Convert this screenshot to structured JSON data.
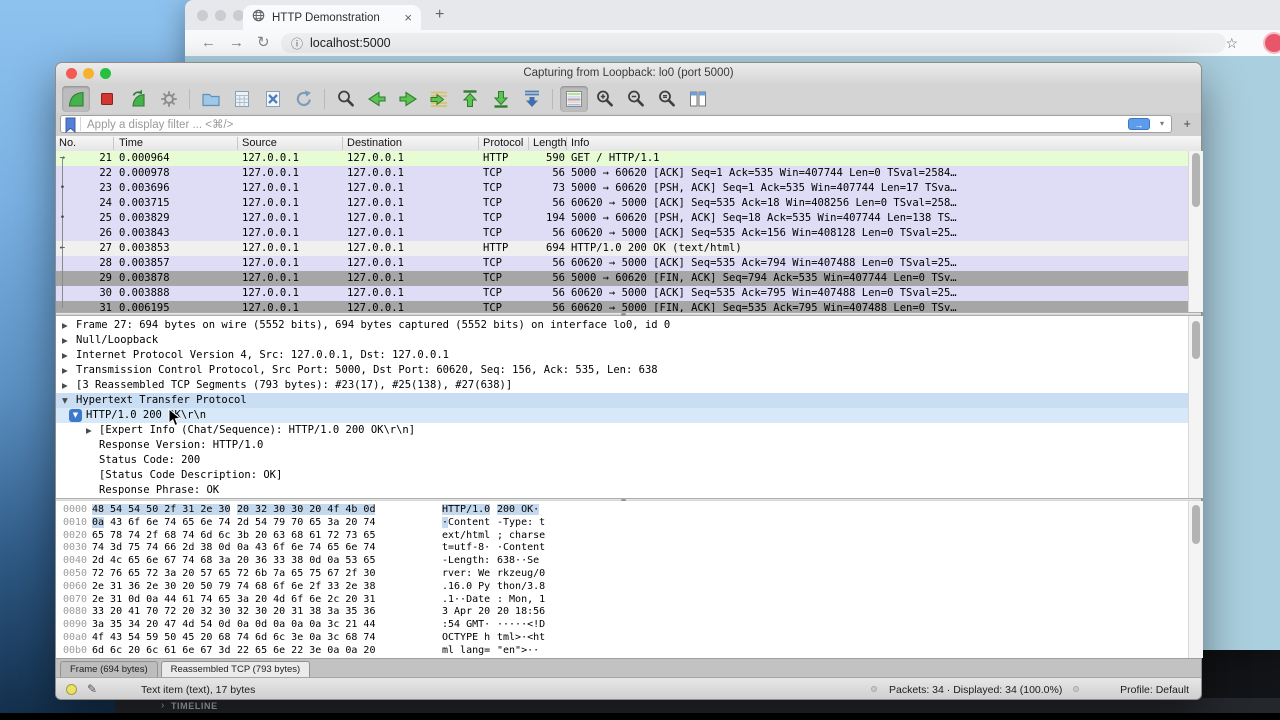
{
  "desktop": {
    "vscode_timeline_label": "TIMELINE"
  },
  "browser": {
    "tab_title": "HTTP Demonstration",
    "close_tab_label": "×",
    "new_tab_label": "+",
    "url": "localhost:5000"
  },
  "colors": {
    "http_row": "#e7fbd4",
    "tcp_row": "#dfddf6",
    "fin_row": "#a6a6a6",
    "selected_row": "#f0f0ee",
    "protocol_row": "#c9def2",
    "selected_field": "#d7e8f9",
    "hex_highlight": "#c5d9ee",
    "accent_blue": "#5c9ceb"
  },
  "wireshark": {
    "title": "Capturing from Loopback: lo0 (port 5000)",
    "filter": {
      "placeholder": "Apply a display filter ... <⌘/>",
      "apply_label": "→",
      "caret_label": "▾",
      "add_label": "+"
    },
    "toolbar": {
      "groups": [
        [
          "start-capture",
          "stop-capture",
          "restart-capture",
          "capture-options"
        ],
        [
          "open-file",
          "save-file",
          "close-file",
          "reload-file"
        ],
        [
          "find-packet",
          "go-back",
          "go-forward",
          "go-to-packet",
          "go-first-packet",
          "go-last-packet",
          "auto-scroll"
        ],
        [
          "colorize-packets",
          "zoom-in",
          "zoom-out",
          "zoom-original",
          "resize-columns"
        ]
      ],
      "pressed": [
        "start-capture",
        "colorize-packets"
      ]
    },
    "columns": [
      "No.",
      "Time",
      "Source",
      "Destination",
      "Protocol",
      "Length",
      "Info"
    ],
    "packets": [
      {
        "no": "21",
        "time": "0.000964",
        "src": "127.0.0.1",
        "dst": "127.0.0.1",
        "proto": "HTTP",
        "len": "590",
        "info": "GET / HTTP/1.1",
        "color": "http",
        "marker": "→"
      },
      {
        "no": "22",
        "time": "0.000978",
        "src": "127.0.0.1",
        "dst": "127.0.0.1",
        "proto": "TCP",
        "len": "56",
        "info": "5000 → 60620 [ACK] Seq=1 Ack=535 Win=407744 Len=0 TSval=2584…",
        "color": "tcp",
        "marker": ""
      },
      {
        "no": "23",
        "time": "0.003696",
        "src": "127.0.0.1",
        "dst": "127.0.0.1",
        "proto": "TCP",
        "len": "73",
        "info": "5000 → 60620 [PSH, ACK] Seq=1 Ack=535 Win=407744 Len=17 TSva…",
        "color": "tcp",
        "marker": "•"
      },
      {
        "no": "24",
        "time": "0.003715",
        "src": "127.0.0.1",
        "dst": "127.0.0.1",
        "proto": "TCP",
        "len": "56",
        "info": "60620 → 5000 [ACK] Seq=535 Ack=18 Win=408256 Len=0 TSval=258…",
        "color": "tcp",
        "marker": ""
      },
      {
        "no": "25",
        "time": "0.003829",
        "src": "127.0.0.1",
        "dst": "127.0.0.1",
        "proto": "TCP",
        "len": "194",
        "info": "5000 → 60620 [PSH, ACK] Seq=18 Ack=535 Win=407744 Len=138 TS…",
        "color": "tcp",
        "marker": "•"
      },
      {
        "no": "26",
        "time": "0.003843",
        "src": "127.0.0.1",
        "dst": "127.0.0.1",
        "proto": "TCP",
        "len": "56",
        "info": "60620 → 5000 [ACK] Seq=535 Ack=156 Win=408128 Len=0 TSval=25…",
        "color": "tcp",
        "marker": ""
      },
      {
        "no": "27",
        "time": "0.003853",
        "src": "127.0.0.1",
        "dst": "127.0.0.1",
        "proto": "HTTP",
        "len": "694",
        "info": "HTTP/1.0 200 OK  (text/html)",
        "color": "selected",
        "marker": "←"
      },
      {
        "no": "28",
        "time": "0.003857",
        "src": "127.0.0.1",
        "dst": "127.0.0.1",
        "proto": "TCP",
        "len": "56",
        "info": "60620 → 5000 [ACK] Seq=535 Ack=794 Win=407488 Len=0 TSval=25…",
        "color": "tcp",
        "marker": ""
      },
      {
        "no": "29",
        "time": "0.003878",
        "src": "127.0.0.1",
        "dst": "127.0.0.1",
        "proto": "TCP",
        "len": "56",
        "info": "5000 → 60620 [FIN, ACK] Seq=794 Ack=535 Win=407744 Len=0 TSv…",
        "color": "fin",
        "marker": ""
      },
      {
        "no": "30",
        "time": "0.003888",
        "src": "127.0.0.1",
        "dst": "127.0.0.1",
        "proto": "TCP",
        "len": "56",
        "info": "60620 → 5000 [ACK] Seq=535 Ack=795 Win=407488 Len=0 TSval=25…",
        "color": "tcp",
        "marker": ""
      },
      {
        "no": "31",
        "time": "0.006195",
        "src": "127.0.0.1",
        "dst": "127.0.0.1",
        "proto": "TCP",
        "len": "56",
        "info": "60620 → 5000 [FIN, ACK] Seq=535 Ack=795 Win=407488 Len=0 TSv…",
        "color": "fin",
        "marker": ""
      }
    ],
    "details": [
      {
        "level": 0,
        "arrow": "collapsed",
        "text": "Frame 27: 694 bytes on wire (5552 bits), 694 bytes captured (5552 bits) on interface lo0, id 0"
      },
      {
        "level": 0,
        "arrow": "collapsed",
        "text": "Null/Loopback"
      },
      {
        "level": 0,
        "arrow": "collapsed",
        "text": "Internet Protocol Version 4, Src: 127.0.0.1, Dst: 127.0.0.1"
      },
      {
        "level": 0,
        "arrow": "collapsed",
        "text": "Transmission Control Protocol, Src Port: 5000, Dst Port: 60620, Seq: 156, Ack: 535, Len: 638"
      },
      {
        "level": 0,
        "arrow": "collapsed",
        "text": "[3 Reassembled TCP Segments (793 bytes): #23(17), #25(138), #27(638)]"
      },
      {
        "level": 0,
        "arrow": "expanded",
        "text": "Hypertext Transfer Protocol",
        "highlight": "protocol"
      },
      {
        "level": 1,
        "arrow": "expanded",
        "text": "HTTP/1.0 200 OK\\r\\n",
        "highlight": "selected"
      },
      {
        "level": 2,
        "arrow": "collapsed",
        "text": "[Expert Info (Chat/Sequence): HTTP/1.0 200 OK\\r\\n]"
      },
      {
        "level": 2,
        "arrow": "none",
        "text": "Response Version: HTTP/1.0"
      },
      {
        "level": 2,
        "arrow": "none",
        "text": "Status Code: 200"
      },
      {
        "level": 2,
        "arrow": "none",
        "text": "[Status Code Description: OK]"
      },
      {
        "level": 2,
        "arrow": "none",
        "text": "Response Phrase: OK"
      }
    ],
    "hex_rows": [
      {
        "off": "0000",
        "h1": "48 54 54 50 2f 31 2e 30",
        "h2": "20 32 30 30 20 4f 4b 0d",
        "a1": "HTTP/1.0",
        "a2": " 200 OK·",
        "hl": {
          "h1": 23,
          "h2": 23,
          "a1": 8,
          "a2": 8
        }
      },
      {
        "off": "0010",
        "h1": "0a 43 6f 6e 74 65 6e 74",
        "h2": "2d 54 79 70 65 3a 20 74",
        "a1": "·Content",
        "a2": "-Type: t",
        "hl": {
          "h1": 2,
          "a1": 1
        }
      },
      {
        "off": "0020",
        "h1": "65 78 74 2f 68 74 6d 6c",
        "h2": "3b 20 63 68 61 72 73 65",
        "a1": "ext/html",
        "a2": "; charse"
      },
      {
        "off": "0030",
        "h1": "74 3d 75 74 66 2d 38 0d",
        "h2": "0a 43 6f 6e 74 65 6e 74",
        "a1": "t=utf-8·",
        "a2": "·Content"
      },
      {
        "off": "0040",
        "h1": "2d 4c 65 6e 67 74 68 3a",
        "h2": "20 36 33 38 0d 0a 53 65",
        "a1": "-Length:",
        "a2": " 638··Se"
      },
      {
        "off": "0050",
        "h1": "72 76 65 72 3a 20 57 65",
        "h2": "72 6b 7a 65 75 67 2f 30",
        "a1": "rver: We",
        "a2": "rkzeug/0"
      },
      {
        "off": "0060",
        "h1": "2e 31 36 2e 30 20 50 79",
        "h2": "74 68 6f 6e 2f 33 2e 38",
        "a1": ".16.0 Py",
        "a2": "thon/3.8"
      },
      {
        "off": "0070",
        "h1": "2e 31 0d 0a 44 61 74 65",
        "h2": "3a 20 4d 6f 6e 2c 20 31",
        "a1": ".1··Date",
        "a2": ": Mon, 1"
      },
      {
        "off": "0080",
        "h1": "33 20 41 70 72 20 32 30",
        "h2": "32 30 20 31 38 3a 35 36",
        "a1": "3 Apr 20",
        "a2": "20 18:56"
      },
      {
        "off": "0090",
        "h1": "3a 35 34 20 47 4d 54 0d",
        "h2": "0a 0d 0a 0a 0a 3c 21 44",
        "a1": ":54 GMT·",
        "a2": "·····<!D"
      },
      {
        "off": "00a0",
        "h1": "4f 43 54 59 50 45 20 68",
        "h2": "74 6d 6c 3e 0a 3c 68 74",
        "a1": "OCTYPE h",
        "a2": "tml>·<ht"
      },
      {
        "off": "00b0",
        "h1": "6d 6c 20 6c 61 6e 67 3d",
        "h2": "22 65 6e 22 3e 0a 0a 20",
        "a1": "ml lang=",
        "a2": "\"en\">·· "
      }
    ],
    "byte_tabs": [
      {
        "label": "Frame (694 bytes)",
        "active": false
      },
      {
        "label": "Reassembled TCP (793 bytes)",
        "active": true
      }
    ],
    "status": {
      "selection": "Text item (text), 17 bytes",
      "packets": "Packets: 34 · Displayed: 34 (100.0%)",
      "profile": "Profile: Default"
    }
  }
}
